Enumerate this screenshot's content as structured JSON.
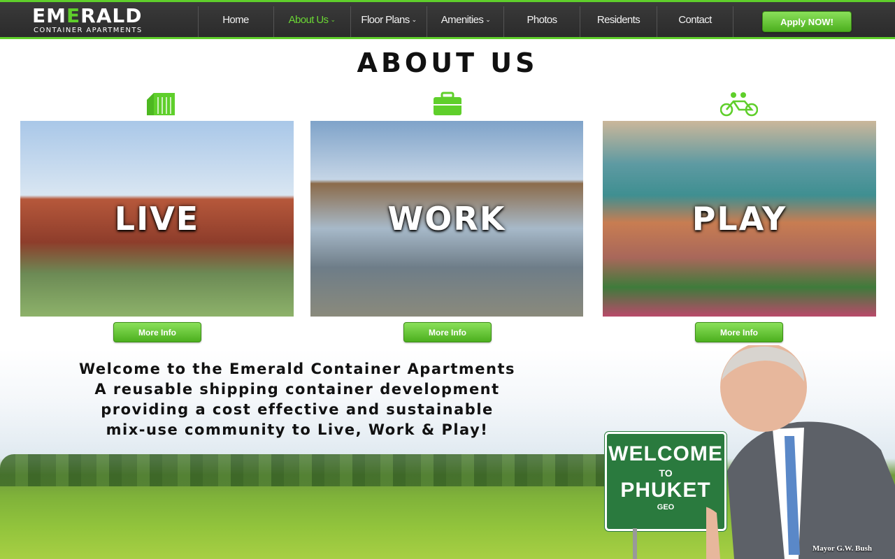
{
  "brand": {
    "name_part1": "EM",
    "name_accent": "E",
    "name_part2": "RALD",
    "tagline": "CONTAINER APARTMENTS"
  },
  "nav": {
    "items": [
      {
        "label": "Home",
        "dropdown": false,
        "active": false
      },
      {
        "label": "About Us",
        "dropdown": true,
        "active": true
      },
      {
        "label": "Floor Plans",
        "dropdown": true,
        "active": false
      },
      {
        "label": "Amenities",
        "dropdown": true,
        "active": false
      },
      {
        "label": "Photos",
        "dropdown": false,
        "active": false
      },
      {
        "label": "Residents",
        "dropdown": false,
        "active": false
      },
      {
        "label": "Contact",
        "dropdown": false,
        "active": false
      }
    ],
    "apply_label": "Apply NOW!",
    "chevron": "⌄"
  },
  "page": {
    "title": "ABOUT US"
  },
  "panels": [
    {
      "label": "LIVE",
      "icon": "container-icon",
      "button": "More Info"
    },
    {
      "label": "WORK",
      "icon": "briefcase-icon",
      "button": "More Info"
    },
    {
      "label": "PLAY",
      "icon": "tandem-bike-icon",
      "button": "More Info"
    }
  ],
  "welcome": {
    "lines": [
      "Welcome to the Emerald Container Apartments",
      "A reusable shipping container development",
      "providing a cost effective and sustainable",
      "mix-use community to Live, Work & Play!"
    ]
  },
  "sign": {
    "line1": "WELCOME",
    "line2": "TO",
    "line3": "PHUKET",
    "line4": "GEO"
  },
  "caption": "Mayor G.W. Bush",
  "colors": {
    "accent": "#5fcf2b",
    "nav_bg": "#2f2f2f",
    "sign_green": "#2a7a3e"
  }
}
